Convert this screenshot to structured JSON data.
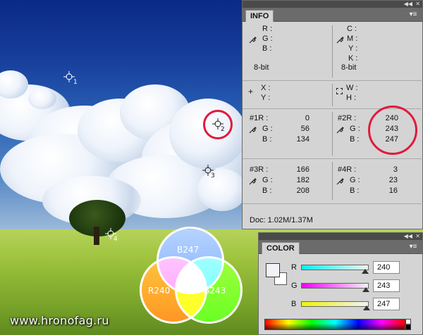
{
  "info_panel": {
    "title": "INFO",
    "rgb_labels": {
      "r": "R :",
      "g": "G :",
      "b": "B :"
    },
    "cmyk_labels": {
      "c": "C :",
      "m": "M :",
      "y": "Y :",
      "k": "K :"
    },
    "bit_left": "8-bit",
    "bit_right": "8-bit",
    "xy_labels": {
      "x": "X :",
      "y": "Y :"
    },
    "wh_labels": {
      "w": "W :",
      "h": "H :"
    },
    "sample1": {
      "r_label": "#1R :",
      "g_label": "G :",
      "b_label": "B :",
      "r": "0",
      "g": "56",
      "b": "134"
    },
    "sample2": {
      "r_label": "#2R :",
      "g_label": "G :",
      "b_label": "B :",
      "r": "240",
      "g": "243",
      "b": "247"
    },
    "sample3": {
      "r_label": "#3R :",
      "g_label": "G :",
      "b_label": "B :",
      "r": "166",
      "g": "182",
      "b": "208"
    },
    "sample4": {
      "r_label": "#4R :",
      "g_label": "G :",
      "b_label": "B :",
      "r": "3",
      "g": "23",
      "b": "16"
    },
    "doc": "Doc: 1.02M/1.37M"
  },
  "color_panel": {
    "title": "COLOR",
    "r_label": "R",
    "g_label": "G",
    "b_label": "B",
    "r_value": "240",
    "g_value": "243",
    "b_value": "247"
  },
  "markers": [
    "1",
    "2",
    "3",
    "4"
  ],
  "venn": {
    "top": "B247",
    "left": "R240",
    "right": "G243"
  },
  "watermark": "www.hronofag.ru",
  "colors": {
    "ring": "#e01a3c",
    "red": "#ff0000",
    "green": "#00ff00",
    "blue": "#0000ff"
  }
}
